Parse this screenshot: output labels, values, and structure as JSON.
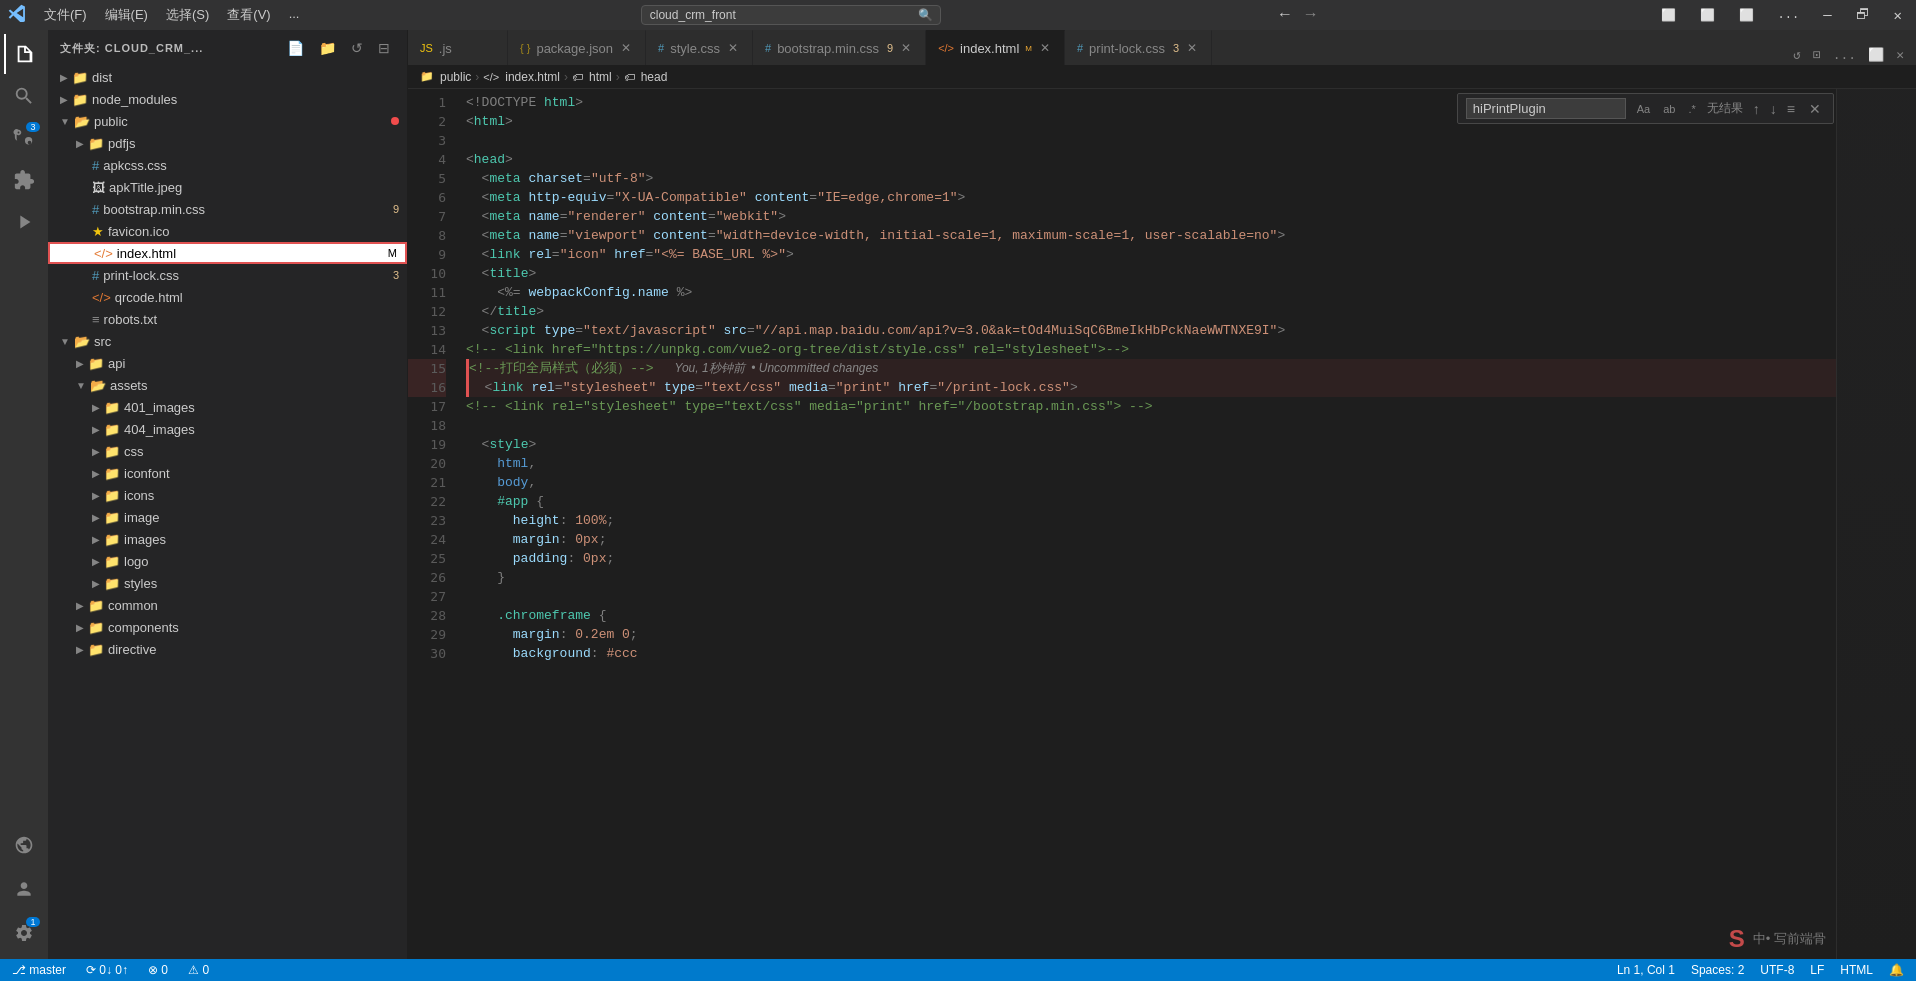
{
  "titleBar": {
    "icon": "VS",
    "menus": [
      "文件(F)",
      "编辑(E)",
      "选择(S)",
      "查看(V)",
      "..."
    ],
    "searchText": "cloud_crm_front",
    "navBack": "←",
    "navForward": "→",
    "windowControls": [
      "⬜",
      "⬜",
      "⬜",
      "...",
      "🗗",
      "✕"
    ]
  },
  "activityBar": {
    "icons": [
      {
        "name": "explorer-icon",
        "label": "Explorer",
        "active": true
      },
      {
        "name": "search-icon",
        "label": "Search",
        "active": false
      },
      {
        "name": "source-control-icon",
        "label": "Source Control",
        "active": false,
        "badge": "3"
      },
      {
        "name": "extensions-icon",
        "label": "Extensions",
        "active": false
      },
      {
        "name": "run-icon",
        "label": "Run",
        "active": false
      }
    ],
    "bottomIcons": [
      {
        "name": "remote-icon",
        "label": "Remote"
      },
      {
        "name": "account-icon",
        "label": "Account"
      },
      {
        "name": "settings-icon",
        "label": "Settings",
        "badge": "1"
      }
    ]
  },
  "sidebar": {
    "header": "文件夹: CLOUD_CRM_...",
    "headerIcons": [
      "New File",
      "New Folder",
      "Refresh",
      "Collapse"
    ],
    "tree": [
      {
        "indent": 0,
        "type": "folder",
        "collapsed": true,
        "name": "dist"
      },
      {
        "indent": 0,
        "type": "folder",
        "collapsed": false,
        "name": "node_modules"
      },
      {
        "indent": 0,
        "type": "folder",
        "collapsed": false,
        "name": "public",
        "dotRed": true
      },
      {
        "indent": 1,
        "type": "folder",
        "collapsed": true,
        "name": "pdfjs"
      },
      {
        "indent": 1,
        "type": "css",
        "name": "apkcss.css"
      },
      {
        "indent": 1,
        "type": "image",
        "name": "apkTitle.jpeg"
      },
      {
        "indent": 1,
        "type": "css",
        "name": "bootstrap.min.css",
        "badge": "9"
      },
      {
        "indent": 1,
        "type": "fav",
        "name": "favicon.ico"
      },
      {
        "indent": 1,
        "type": "html",
        "name": "index.html",
        "modified": "M",
        "selected": true,
        "highlighted": true
      },
      {
        "indent": 1,
        "type": "css",
        "name": "print-lock.css",
        "badge": "3"
      },
      {
        "indent": 1,
        "type": "html",
        "name": "qrcode.html"
      },
      {
        "indent": 1,
        "type": "txt",
        "name": "robots.txt"
      },
      {
        "indent": 0,
        "type": "folder",
        "collapsed": false,
        "name": "src"
      },
      {
        "indent": 1,
        "type": "folder",
        "collapsed": true,
        "name": "api"
      },
      {
        "indent": 1,
        "type": "folder",
        "collapsed": false,
        "name": "assets"
      },
      {
        "indent": 2,
        "type": "folder",
        "collapsed": true,
        "name": "401_images"
      },
      {
        "indent": 2,
        "type": "folder",
        "collapsed": true,
        "name": "404_images"
      },
      {
        "indent": 2,
        "type": "folder",
        "collapsed": true,
        "name": "css"
      },
      {
        "indent": 2,
        "type": "folder",
        "collapsed": true,
        "name": "iconfont"
      },
      {
        "indent": 2,
        "type": "folder",
        "collapsed": true,
        "name": "icons"
      },
      {
        "indent": 2,
        "type": "folder",
        "collapsed": true,
        "name": "image"
      },
      {
        "indent": 2,
        "type": "folder",
        "collapsed": true,
        "name": "images"
      },
      {
        "indent": 2,
        "type": "folder",
        "collapsed": true,
        "name": "logo"
      },
      {
        "indent": 2,
        "type": "folder",
        "collapsed": true,
        "name": "styles"
      },
      {
        "indent": 1,
        "type": "folder",
        "collapsed": true,
        "name": "common"
      },
      {
        "indent": 1,
        "type": "folder",
        "collapsed": true,
        "name": "components"
      },
      {
        "indent": 1,
        "type": "folder",
        "collapsed": true,
        "name": "directive"
      }
    ]
  },
  "tabs": [
    {
      "label": ".js",
      "active": false,
      "modified": false,
      "icon": "js"
    },
    {
      "label": "package.json",
      "active": false,
      "modified": false,
      "icon": "json",
      "paused": true
    },
    {
      "label": "style.css",
      "active": false,
      "modified": false,
      "icon": "css",
      "hash": true
    },
    {
      "label": "bootstrap.min.css",
      "active": false,
      "modified": false,
      "icon": "css",
      "hash": true,
      "badge": "9"
    },
    {
      "label": "index.html",
      "active": true,
      "modified": true,
      "icon": "html",
      "modBadge": "M"
    },
    {
      "label": "print-lock.css",
      "active": false,
      "modified": false,
      "icon": "css",
      "hash": true,
      "badge": "3"
    }
  ],
  "breadcrumb": [
    "public",
    "index.html",
    "html",
    "head"
  ],
  "findWidget": {
    "inputValue": "hiPrintPlugin",
    "options": [
      "Aa",
      "ab",
      ".*"
    ],
    "result": "无结果",
    "navUp": "↑",
    "navDown": "↓",
    "menuIcon": "≡",
    "closeIcon": "✕"
  },
  "codeLines": [
    {
      "num": 1,
      "tokens": [
        {
          "t": "t-punct",
          "v": "<!DOCTYPE "
        },
        {
          "t": "t-tag",
          "v": "html"
        },
        {
          "t": "t-punct",
          "v": ">"
        }
      ]
    },
    {
      "num": 2,
      "tokens": [
        {
          "t": "t-punct",
          "v": "<"
        },
        {
          "t": "t-tag",
          "v": "html"
        },
        {
          "t": "t-punct",
          "v": ">"
        }
      ]
    },
    {
      "num": 3,
      "tokens": []
    },
    {
      "num": 4,
      "tokens": [
        {
          "t": "t-punct",
          "v": "<"
        },
        {
          "t": "t-tag",
          "v": "head"
        },
        {
          "t": "t-punct",
          "v": ">"
        }
      ]
    },
    {
      "num": 5,
      "tokens": [
        {
          "t": "t-text",
          "v": "  "
        },
        {
          "t": "t-punct",
          "v": "<"
        },
        {
          "t": "t-tag",
          "v": "meta"
        },
        {
          "t": "t-text",
          "v": " "
        },
        {
          "t": "t-attr",
          "v": "charset"
        },
        {
          "t": "t-punct",
          "v": "="
        },
        {
          "t": "t-value",
          "v": "\"utf-8\""
        },
        {
          "t": "t-punct",
          "v": ">"
        }
      ]
    },
    {
      "num": 6,
      "tokens": [
        {
          "t": "t-text",
          "v": "  "
        },
        {
          "t": "t-punct",
          "v": "<"
        },
        {
          "t": "t-tag",
          "v": "meta"
        },
        {
          "t": "t-text",
          "v": " "
        },
        {
          "t": "t-attr",
          "v": "http-equiv"
        },
        {
          "t": "t-punct",
          "v": "="
        },
        {
          "t": "t-value",
          "v": "\"X-UA-Compatible\""
        },
        {
          "t": "t-text",
          "v": " "
        },
        {
          "t": "t-attr",
          "v": "content"
        },
        {
          "t": "t-punct",
          "v": "="
        },
        {
          "t": "t-value",
          "v": "\"IE=edge,chrome=1\""
        },
        {
          "t": "t-punct",
          "v": ">"
        }
      ]
    },
    {
      "num": 7,
      "tokens": [
        {
          "t": "t-text",
          "v": "  "
        },
        {
          "t": "t-punct",
          "v": "<"
        },
        {
          "t": "t-tag",
          "v": "meta"
        },
        {
          "t": "t-text",
          "v": " "
        },
        {
          "t": "t-attr",
          "v": "name"
        },
        {
          "t": "t-punct",
          "v": "="
        },
        {
          "t": "t-value",
          "v": "\"renderer\""
        },
        {
          "t": "t-text",
          "v": " "
        },
        {
          "t": "t-attr",
          "v": "content"
        },
        {
          "t": "t-punct",
          "v": "="
        },
        {
          "t": "t-value",
          "v": "\"webkit\""
        },
        {
          "t": "t-punct",
          "v": ">"
        }
      ]
    },
    {
      "num": 8,
      "tokens": [
        {
          "t": "t-text",
          "v": "  "
        },
        {
          "t": "t-punct",
          "v": "<"
        },
        {
          "t": "t-tag",
          "v": "meta"
        },
        {
          "t": "t-text",
          "v": " "
        },
        {
          "t": "t-attr",
          "v": "name"
        },
        {
          "t": "t-punct",
          "v": "="
        },
        {
          "t": "t-value",
          "v": "\"viewport\""
        },
        {
          "t": "t-text",
          "v": " "
        },
        {
          "t": "t-attr",
          "v": "content"
        },
        {
          "t": "t-punct",
          "v": "="
        },
        {
          "t": "t-value",
          "v": "\"width=device-width, initial-scale=1, maximum-scale=1, user-scalable=no\""
        },
        {
          "t": "t-punct",
          "v": ">"
        }
      ]
    },
    {
      "num": 9,
      "tokens": [
        {
          "t": "t-text",
          "v": "  "
        },
        {
          "t": "t-punct",
          "v": "<"
        },
        {
          "t": "t-tag",
          "v": "link"
        },
        {
          "t": "t-text",
          "v": " "
        },
        {
          "t": "t-attr",
          "v": "rel"
        },
        {
          "t": "t-punct",
          "v": "="
        },
        {
          "t": "t-value",
          "v": "\"icon\""
        },
        {
          "t": "t-text",
          "v": " "
        },
        {
          "t": "t-attr",
          "v": "href"
        },
        {
          "t": "t-punct",
          "v": "="
        },
        {
          "t": "t-value",
          "v": "\"<%= BASE_URL %>\""
        },
        {
          "t": "t-punct",
          "v": ">"
        }
      ]
    },
    {
      "num": 10,
      "tokens": [
        {
          "t": "t-text",
          "v": "  "
        },
        {
          "t": "t-punct",
          "v": "<"
        },
        {
          "t": "t-tag",
          "v": "title"
        },
        {
          "t": "t-punct",
          "v": ">"
        }
      ]
    },
    {
      "num": 11,
      "tokens": [
        {
          "t": "t-text",
          "v": "    "
        },
        {
          "t": "t-punct",
          "v": "<%= "
        },
        {
          "t": "t-attr",
          "v": "webpackConfig.name"
        },
        {
          "t": "t-punct",
          "v": " %>"
        }
      ]
    },
    {
      "num": 12,
      "tokens": [
        {
          "t": "t-text",
          "v": "  "
        },
        {
          "t": "t-punct",
          "v": "</"
        },
        {
          "t": "t-tag",
          "v": "title"
        },
        {
          "t": "t-punct",
          "v": ">"
        }
      ]
    },
    {
      "num": 13,
      "tokens": [
        {
          "t": "t-text",
          "v": "  "
        },
        {
          "t": "t-punct",
          "v": "<"
        },
        {
          "t": "t-tag",
          "v": "script"
        },
        {
          "t": "t-text",
          "v": " "
        },
        {
          "t": "t-attr",
          "v": "type"
        },
        {
          "t": "t-punct",
          "v": "="
        },
        {
          "t": "t-value",
          "v": "\"text/javascript\""
        },
        {
          "t": "t-text",
          "v": " "
        },
        {
          "t": "t-attr",
          "v": "src"
        },
        {
          "t": "t-punct",
          "v": "="
        },
        {
          "t": "t-value",
          "v": "\"//api.map.baidu.com/api?v=3.0&ak=tOd4MuiSqC6BmeIkHbPckNaeWWTNXE9I\""
        },
        {
          "t": "t-punct",
          "v": ">"
        }
      ]
    },
    {
      "num": 14,
      "tokens": [
        {
          "t": "t-comment",
          "v": "<!-- "
        },
        {
          "t": "t-comment",
          "v": "<link href=\"https://unpkg.com/vue2-org-tree/dist/style.css\" rel=\"stylesheet\">"
        },
        {
          "t": "t-comment",
          "v": "-->"
        }
      ]
    },
    {
      "num": 15,
      "tokens": [
        {
          "t": "t-comment",
          "v": "<!--打印全局样式（必须）--> "
        },
        {
          "t": "t-uncommitted",
          "v": "    You, 1秒钟前  • Uncommitted changes"
        }
      ],
      "redBox": true
    },
    {
      "num": 16,
      "tokens": [
        {
          "t": "t-punct",
          "v": "  <"
        },
        {
          "t": "t-tag",
          "v": "link"
        },
        {
          "t": "t-text",
          "v": " "
        },
        {
          "t": "t-attr",
          "v": "rel"
        },
        {
          "t": "t-punct",
          "v": "="
        },
        {
          "t": "t-value",
          "v": "\"stylesheet\""
        },
        {
          "t": "t-text",
          "v": " "
        },
        {
          "t": "t-attr",
          "v": "type"
        },
        {
          "t": "t-punct",
          "v": "="
        },
        {
          "t": "t-value",
          "v": "\"text/css\""
        },
        {
          "t": "t-text",
          "v": " "
        },
        {
          "t": "t-attr",
          "v": "media"
        },
        {
          "t": "t-punct",
          "v": "="
        },
        {
          "t": "t-value",
          "v": "\"print\""
        },
        {
          "t": "t-text",
          "v": " "
        },
        {
          "t": "t-attr",
          "v": "href"
        },
        {
          "t": "t-punct",
          "v": "="
        },
        {
          "t": "t-value",
          "v": "\"/print-lock.css\""
        },
        {
          "t": "t-punct",
          "v": ">"
        }
      ],
      "redBox": true
    },
    {
      "num": 17,
      "tokens": [
        {
          "t": "t-comment",
          "v": "<!-- <link rel=\"stylesheet\" type=\"text/css\" media=\"print\" href=\"/bootstrap.min.css\"> -->"
        }
      ]
    },
    {
      "num": 18,
      "tokens": []
    },
    {
      "num": 19,
      "tokens": [
        {
          "t": "t-text",
          "v": "  "
        },
        {
          "t": "t-punct",
          "v": "<"
        },
        {
          "t": "t-tag",
          "v": "style"
        },
        {
          "t": "t-punct",
          "v": ">"
        }
      ]
    },
    {
      "num": 20,
      "tokens": [
        {
          "t": "t-text",
          "v": "    "
        },
        {
          "t": "t-keyword",
          "v": "html"
        },
        {
          "t": "t-punct",
          "v": ","
        }
      ]
    },
    {
      "num": 21,
      "tokens": [
        {
          "t": "t-text",
          "v": "    "
        },
        {
          "t": "t-keyword",
          "v": "body"
        },
        {
          "t": "t-punct",
          "v": ","
        }
      ]
    },
    {
      "num": 22,
      "tokens": [
        {
          "t": "t-text",
          "v": "    "
        },
        {
          "t": "t-tag",
          "v": "#app"
        },
        {
          "t": "t-text",
          "v": " "
        },
        {
          "t": "t-punct",
          "v": "{"
        }
      ]
    },
    {
      "num": 23,
      "tokens": [
        {
          "t": "t-text",
          "v": "      "
        },
        {
          "t": "t-attr",
          "v": "height"
        },
        {
          "t": "t-punct",
          "v": ": "
        },
        {
          "t": "t-value",
          "v": "100%"
        },
        {
          "t": "t-punct",
          "v": ";"
        }
      ]
    },
    {
      "num": 24,
      "tokens": [
        {
          "t": "t-text",
          "v": "      "
        },
        {
          "t": "t-attr",
          "v": "margin"
        },
        {
          "t": "t-punct",
          "v": ": "
        },
        {
          "t": "t-value",
          "v": "0px"
        },
        {
          "t": "t-punct",
          "v": ";"
        }
      ]
    },
    {
      "num": 25,
      "tokens": [
        {
          "t": "t-text",
          "v": "      "
        },
        {
          "t": "t-attr",
          "v": "padding"
        },
        {
          "t": "t-punct",
          "v": ": "
        },
        {
          "t": "t-value",
          "v": "0px"
        },
        {
          "t": "t-punct",
          "v": ";"
        }
      ]
    },
    {
      "num": 26,
      "tokens": [
        {
          "t": "t-text",
          "v": "    "
        },
        {
          "t": "t-punct",
          "v": "}"
        }
      ]
    },
    {
      "num": 27,
      "tokens": []
    },
    {
      "num": 28,
      "tokens": [
        {
          "t": "t-text",
          "v": "    "
        },
        {
          "t": "t-tag",
          "v": ".chromeframe"
        },
        {
          "t": "t-text",
          "v": " "
        },
        {
          "t": "t-punct",
          "v": "{"
        }
      ]
    },
    {
      "num": 29,
      "tokens": [
        {
          "t": "t-text",
          "v": "      "
        },
        {
          "t": "t-attr",
          "v": "margin"
        },
        {
          "t": "t-punct",
          "v": ": "
        },
        {
          "t": "t-value",
          "v": "0.2em 0"
        },
        {
          "t": "t-punct",
          "v": ";"
        }
      ]
    },
    {
      "num": 30,
      "tokens": [
        {
          "t": "t-text",
          "v": "      "
        },
        {
          "t": "t-attr",
          "v": "background"
        },
        {
          "t": "t-punct",
          "v": ": "
        },
        {
          "t": "t-value",
          "v": "#ccc"
        }
      ]
    }
  ],
  "statusBar": {
    "branch": "⎇  master",
    "sync": "⟳ 0↓ 0↑",
    "errors": "⊗ 0",
    "warnings": "⚠ 0",
    "right": {
      "lineCol": "Ln 1, Col 1",
      "spaces": "Spaces: 2",
      "encoding": "UTF-8",
      "lineEnding": "LF",
      "language": "HTML",
      "feedback": "🔔"
    }
  },
  "watermark": {
    "logo": "S",
    "text": "中• 写前端骨"
  }
}
